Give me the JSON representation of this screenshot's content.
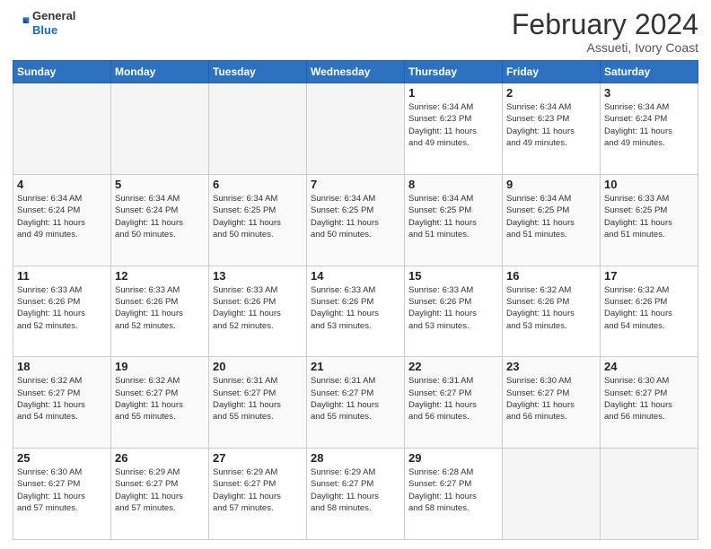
{
  "header": {
    "logo_general": "General",
    "logo_blue": "Blue",
    "month_title": "February 2024",
    "location": "Assueti, Ivory Coast"
  },
  "days_of_week": [
    "Sunday",
    "Monday",
    "Tuesday",
    "Wednesday",
    "Thursday",
    "Friday",
    "Saturday"
  ],
  "weeks": [
    [
      {
        "day": "",
        "info": ""
      },
      {
        "day": "",
        "info": ""
      },
      {
        "day": "",
        "info": ""
      },
      {
        "day": "",
        "info": ""
      },
      {
        "day": "1",
        "info": "Sunrise: 6:34 AM\nSunset: 6:23 PM\nDaylight: 11 hours\nand 49 minutes."
      },
      {
        "day": "2",
        "info": "Sunrise: 6:34 AM\nSunset: 6:23 PM\nDaylight: 11 hours\nand 49 minutes."
      },
      {
        "day": "3",
        "info": "Sunrise: 6:34 AM\nSunset: 6:24 PM\nDaylight: 11 hours\nand 49 minutes."
      }
    ],
    [
      {
        "day": "4",
        "info": "Sunrise: 6:34 AM\nSunset: 6:24 PM\nDaylight: 11 hours\nand 49 minutes."
      },
      {
        "day": "5",
        "info": "Sunrise: 6:34 AM\nSunset: 6:24 PM\nDaylight: 11 hours\nand 50 minutes."
      },
      {
        "day": "6",
        "info": "Sunrise: 6:34 AM\nSunset: 6:25 PM\nDaylight: 11 hours\nand 50 minutes."
      },
      {
        "day": "7",
        "info": "Sunrise: 6:34 AM\nSunset: 6:25 PM\nDaylight: 11 hours\nand 50 minutes."
      },
      {
        "day": "8",
        "info": "Sunrise: 6:34 AM\nSunset: 6:25 PM\nDaylight: 11 hours\nand 51 minutes."
      },
      {
        "day": "9",
        "info": "Sunrise: 6:34 AM\nSunset: 6:25 PM\nDaylight: 11 hours\nand 51 minutes."
      },
      {
        "day": "10",
        "info": "Sunrise: 6:33 AM\nSunset: 6:25 PM\nDaylight: 11 hours\nand 51 minutes."
      }
    ],
    [
      {
        "day": "11",
        "info": "Sunrise: 6:33 AM\nSunset: 6:26 PM\nDaylight: 11 hours\nand 52 minutes."
      },
      {
        "day": "12",
        "info": "Sunrise: 6:33 AM\nSunset: 6:26 PM\nDaylight: 11 hours\nand 52 minutes."
      },
      {
        "day": "13",
        "info": "Sunrise: 6:33 AM\nSunset: 6:26 PM\nDaylight: 11 hours\nand 52 minutes."
      },
      {
        "day": "14",
        "info": "Sunrise: 6:33 AM\nSunset: 6:26 PM\nDaylight: 11 hours\nand 53 minutes."
      },
      {
        "day": "15",
        "info": "Sunrise: 6:33 AM\nSunset: 6:26 PM\nDaylight: 11 hours\nand 53 minutes."
      },
      {
        "day": "16",
        "info": "Sunrise: 6:32 AM\nSunset: 6:26 PM\nDaylight: 11 hours\nand 53 minutes."
      },
      {
        "day": "17",
        "info": "Sunrise: 6:32 AM\nSunset: 6:26 PM\nDaylight: 11 hours\nand 54 minutes."
      }
    ],
    [
      {
        "day": "18",
        "info": "Sunrise: 6:32 AM\nSunset: 6:27 PM\nDaylight: 11 hours\nand 54 minutes."
      },
      {
        "day": "19",
        "info": "Sunrise: 6:32 AM\nSunset: 6:27 PM\nDaylight: 11 hours\nand 55 minutes."
      },
      {
        "day": "20",
        "info": "Sunrise: 6:31 AM\nSunset: 6:27 PM\nDaylight: 11 hours\nand 55 minutes."
      },
      {
        "day": "21",
        "info": "Sunrise: 6:31 AM\nSunset: 6:27 PM\nDaylight: 11 hours\nand 55 minutes."
      },
      {
        "day": "22",
        "info": "Sunrise: 6:31 AM\nSunset: 6:27 PM\nDaylight: 11 hours\nand 56 minutes."
      },
      {
        "day": "23",
        "info": "Sunrise: 6:30 AM\nSunset: 6:27 PM\nDaylight: 11 hours\nand 56 minutes."
      },
      {
        "day": "24",
        "info": "Sunrise: 6:30 AM\nSunset: 6:27 PM\nDaylight: 11 hours\nand 56 minutes."
      }
    ],
    [
      {
        "day": "25",
        "info": "Sunrise: 6:30 AM\nSunset: 6:27 PM\nDaylight: 11 hours\nand 57 minutes."
      },
      {
        "day": "26",
        "info": "Sunrise: 6:29 AM\nSunset: 6:27 PM\nDaylight: 11 hours\nand 57 minutes."
      },
      {
        "day": "27",
        "info": "Sunrise: 6:29 AM\nSunset: 6:27 PM\nDaylight: 11 hours\nand 57 minutes."
      },
      {
        "day": "28",
        "info": "Sunrise: 6:29 AM\nSunset: 6:27 PM\nDaylight: 11 hours\nand 58 minutes."
      },
      {
        "day": "29",
        "info": "Sunrise: 6:28 AM\nSunset: 6:27 PM\nDaylight: 11 hours\nand 58 minutes."
      },
      {
        "day": "",
        "info": ""
      },
      {
        "day": "",
        "info": ""
      }
    ]
  ]
}
